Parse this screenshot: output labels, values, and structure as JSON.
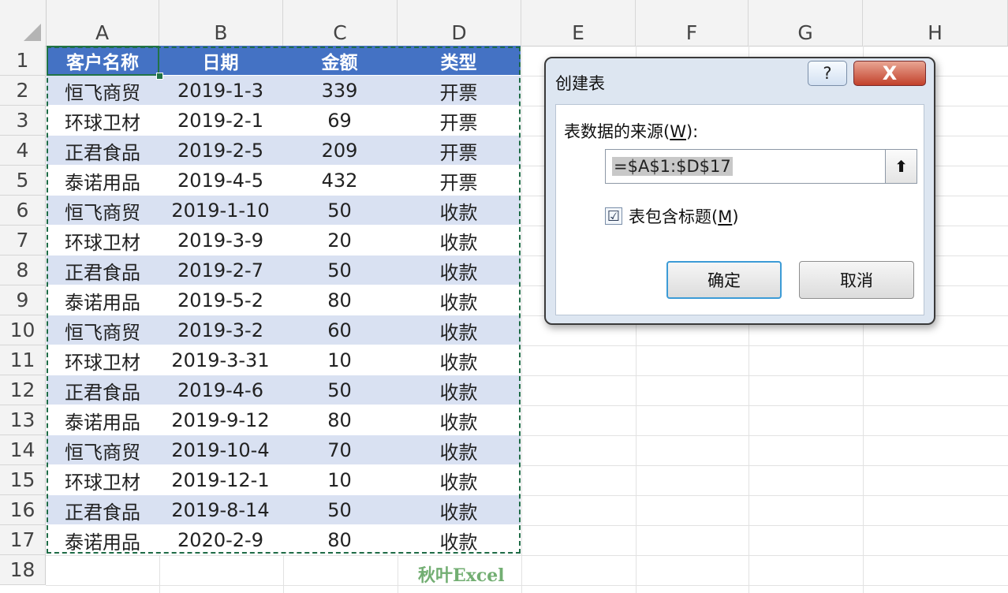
{
  "columns": [
    "A",
    "B",
    "C",
    "D",
    "E",
    "F",
    "G",
    "H"
  ],
  "rows": [
    "1",
    "2",
    "3",
    "4",
    "5",
    "6",
    "7",
    "8",
    "9",
    "10",
    "11",
    "12",
    "13",
    "14",
    "15",
    "16",
    "17",
    "18"
  ],
  "table": {
    "headers": [
      "客户名称",
      "日期",
      "金额",
      "类型"
    ],
    "rows": [
      [
        "恒飞商贸",
        "2019-1-3",
        "339",
        "开票"
      ],
      [
        "环球卫材",
        "2019-2-1",
        "69",
        "开票"
      ],
      [
        "正君食品",
        "2019-2-5",
        "209",
        "开票"
      ],
      [
        "泰诺用品",
        "2019-4-5",
        "432",
        "开票"
      ],
      [
        "恒飞商贸",
        "2019-1-10",
        "50",
        "收款"
      ],
      [
        "环球卫材",
        "2019-3-9",
        "20",
        "收款"
      ],
      [
        "正君食品",
        "2019-2-7",
        "50",
        "收款"
      ],
      [
        "泰诺用品",
        "2019-5-2",
        "80",
        "收款"
      ],
      [
        "恒飞商贸",
        "2019-3-2",
        "60",
        "收款"
      ],
      [
        "环球卫材",
        "2019-3-31",
        "10",
        "收款"
      ],
      [
        "正君食品",
        "2019-4-6",
        "50",
        "收款"
      ],
      [
        "泰诺用品",
        "2019-9-12",
        "80",
        "收款"
      ],
      [
        "恒飞商贸",
        "2019-10-4",
        "70",
        "收款"
      ],
      [
        "环球卫材",
        "2019-12-1",
        "10",
        "收款"
      ],
      [
        "正君食品",
        "2019-8-14",
        "50",
        "收款"
      ],
      [
        "泰诺用品",
        "2020-2-9",
        "80",
        "收款"
      ]
    ]
  },
  "dialog": {
    "title": "创建表",
    "help_label": "?",
    "close_label": "X",
    "source_label_pre": "表数据的来源(",
    "source_label_key": "W",
    "source_label_post": "):",
    "range_value": "=$A$1:$D$17",
    "collapse_label": "⬆",
    "checkbox_checked": true,
    "checkbox_mark": "☑",
    "checkbox_label_pre": "表包含标题(",
    "checkbox_label_key": "M",
    "checkbox_label_post": ")",
    "ok_label": "确定",
    "cancel_label": "取消"
  },
  "watermark": "秋叶Excel",
  "colors": {
    "header_fill": "#4472c4",
    "band_fill": "#d9e1f2",
    "selection": "#217346"
  }
}
